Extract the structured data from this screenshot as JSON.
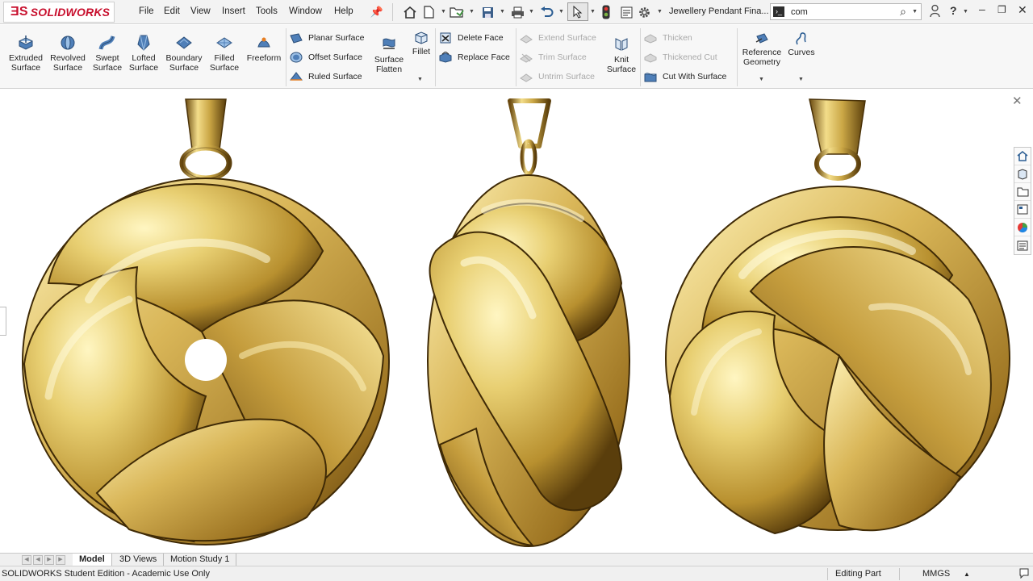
{
  "app": {
    "brand": "SOLIDWORKS",
    "brand_color": "#c8102e"
  },
  "menu": [
    "File",
    "Edit",
    "View",
    "Insert",
    "Tools",
    "Window",
    "Help"
  ],
  "document_title": "Jewellery Pendant Fina...",
  "search": {
    "value": "com"
  },
  "ribbon": {
    "large_buttons": [
      {
        "line1": "Extruded",
        "line2": "Surface",
        "icon": "extruded-surface-icon"
      },
      {
        "line1": "Revolved",
        "line2": "Surface",
        "icon": "revolved-surface-icon"
      },
      {
        "line1": "Swept",
        "line2": "Surface",
        "icon": "swept-surface-icon"
      },
      {
        "line1": "Lofted",
        "line2": "Surface",
        "icon": "lofted-surface-icon"
      },
      {
        "line1": "Boundary",
        "line2": "Surface",
        "icon": "boundary-surface-icon"
      },
      {
        "line1": "Filled",
        "line2": "Surface",
        "icon": "filled-surface-icon"
      },
      {
        "line1": "Freeform",
        "line2": "",
        "icon": "freeform-icon"
      }
    ],
    "group1": [
      "Planar Surface",
      "Offset Surface",
      "Ruled Surface"
    ],
    "flatten": {
      "line1": "Surface",
      "line2": "Flatten"
    },
    "fillet": "Fillet",
    "group2": [
      "Delete Face",
      "Replace Face"
    ],
    "group3": [
      "Extend Surface",
      "Trim Surface",
      "Untrim Surface"
    ],
    "knit": {
      "line1": "Knit",
      "line2": "Surface"
    },
    "group4": [
      "Thicken",
      "Thickened Cut",
      "Cut With Surface"
    ],
    "reference": {
      "line1": "Reference",
      "line2": "Geometry"
    },
    "curves": "Curves"
  },
  "tabs": [
    "Model",
    "3D Views",
    "Motion Study 1"
  ],
  "active_tab": "Model",
  "status": {
    "edition": "SOLIDWORKS Student Edition - Academic Use Only",
    "mode": "Editing Part",
    "units": "MMGS"
  },
  "gold_colors": {
    "highlight": "#fff6c2",
    "light": "#e8cf72",
    "mid": "#b8902f",
    "dark": "#5a3e0c"
  }
}
